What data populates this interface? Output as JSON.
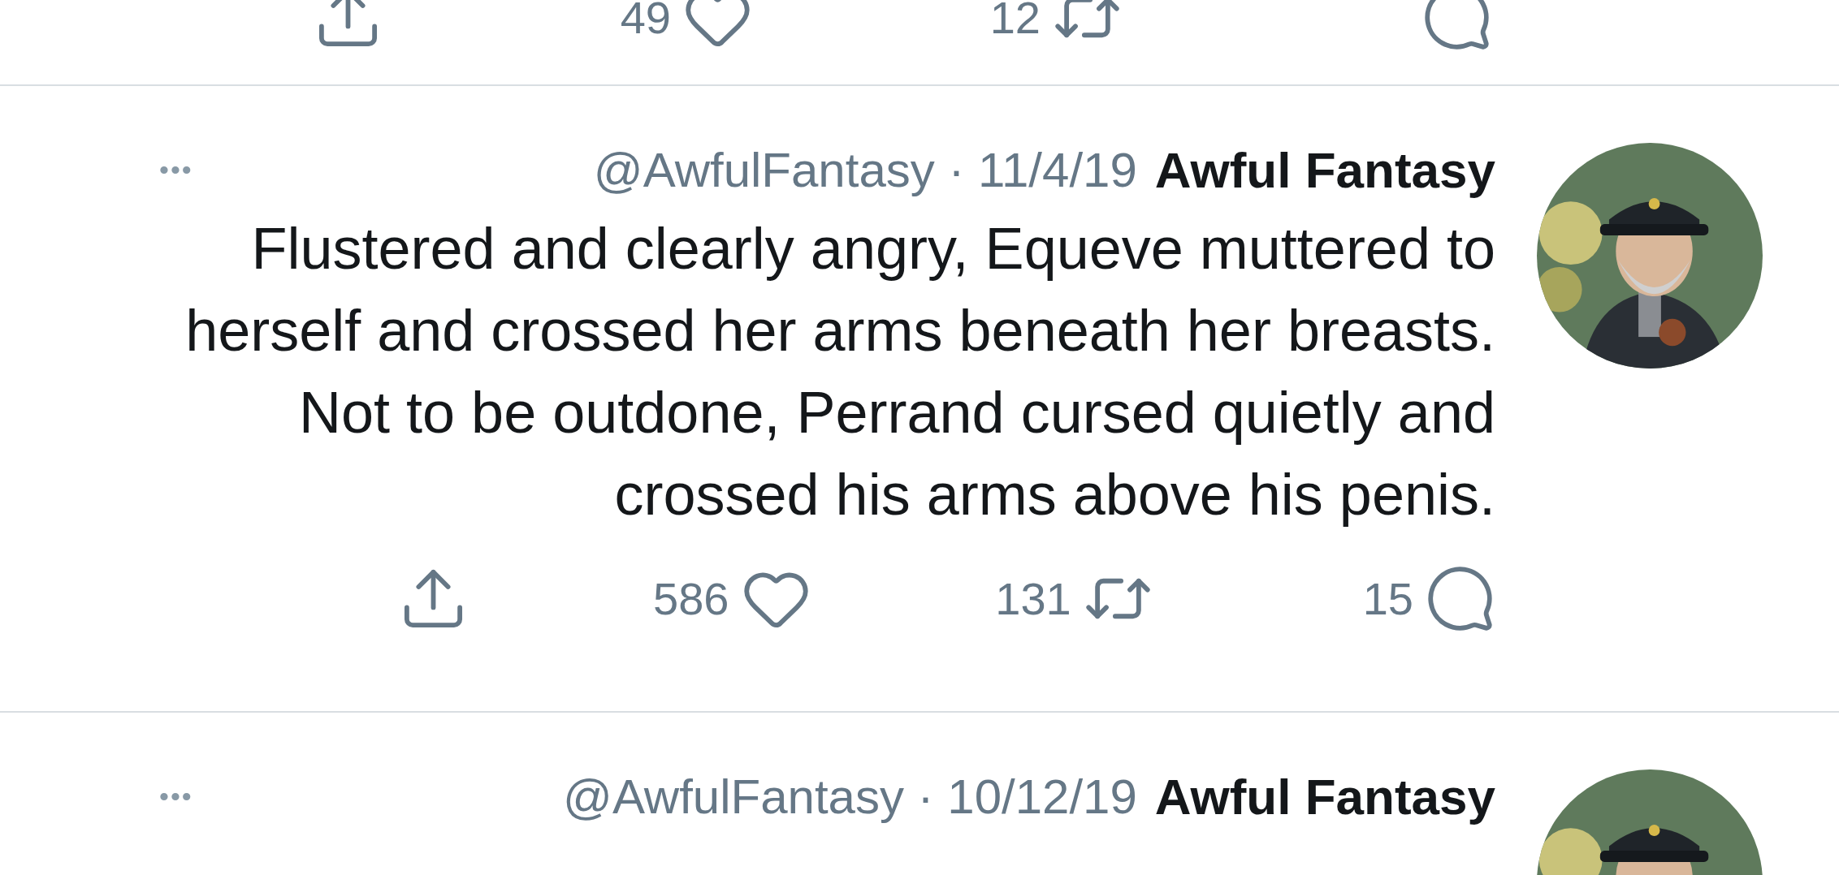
{
  "tweets": [
    {
      "actions": [
        {
          "kind": "share"
        },
        {
          "kind": "like",
          "count": "49"
        },
        {
          "kind": "retweet",
          "count": "12"
        },
        {
          "kind": "reply"
        }
      ]
    },
    {
      "author": "Awful Fantasy",
      "meta": "@AwfulFantasy · 11/4/19",
      "menu": "•••",
      "text": "Flustered and clearly angry, Equeve muttered to herself and crossed her arms beneath her breasts. Not to be outdone, Perrand cursed quietly and crossed his arms above his penis.",
      "actions": [
        {
          "kind": "share"
        },
        {
          "kind": "like",
          "count": "586"
        },
        {
          "kind": "retweet",
          "count": "131"
        },
        {
          "kind": "reply",
          "count": "15"
        }
      ]
    },
    {
      "author": "Awful Fantasy",
      "meta": "@AwfulFantasy · 10/12/19",
      "menu": "•••"
    }
  ]
}
